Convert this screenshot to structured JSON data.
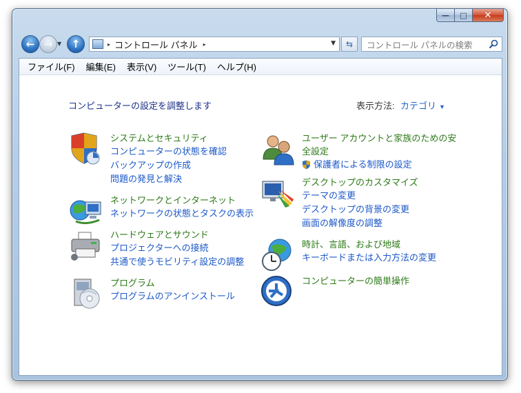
{
  "window": {
    "buttons": {
      "minimize": "—",
      "maximize": "□",
      "close": "✕"
    }
  },
  "nav": {
    "back_icon": "back-arrow-icon",
    "forward_icon": "forward-arrow-icon",
    "up_icon": "up-arrow-icon",
    "back_glyph": "←",
    "forward_glyph": "→",
    "up_glyph": "↑",
    "recent_glyph": "▼",
    "crumb_arrow": "▸",
    "address_crumb": "コントロール パネル",
    "address_drop_glyph": "▼",
    "refresh_glyph": "⇆",
    "search_placeholder": "コントロール パネルの検索"
  },
  "menu": [
    "ファイル(F)",
    "編集(E)",
    "表示(V)",
    "ツール(T)",
    "ヘルプ(H)"
  ],
  "page": {
    "title": "コンピューターの設定を調整します",
    "view_by_label": "表示方法:",
    "view_by_value": "カテゴリ",
    "view_by_caret": "▼"
  },
  "categories_left": [
    {
      "title": "システムとセキュリティ",
      "icon": "shield-icon",
      "links": [
        "コンピューターの状態を確認",
        "バックアップの作成",
        "問題の発見と解決"
      ]
    },
    {
      "title": "ネットワークとインターネット",
      "icon": "network-globe-icon",
      "links": [
        "ネットワークの状態とタスクの表示"
      ]
    },
    {
      "title": "ハードウェアとサウンド",
      "icon": "printer-icon",
      "links": [
        "プロジェクターへの接続",
        "共通で使うモビリティ設定の調整"
      ]
    },
    {
      "title": "プログラム",
      "icon": "programs-disc-icon",
      "links": [
        "プログラムのアンインストール"
      ]
    }
  ],
  "categories_right": [
    {
      "title": "ユーザー アカウントと家族のための安全設定",
      "icon": "users-icon",
      "links": [
        "保護者による制限の設定"
      ]
    },
    {
      "title": "デスクトップのカスタマイズ",
      "icon": "monitor-palette-icon",
      "links": [
        "テーマの変更",
        "デスクトップの背景の変更",
        "画面の解像度の調整"
      ]
    },
    {
      "title": "時計、言語、および地域",
      "icon": "clock-globe-icon",
      "links": [
        "キーボードまたは入力方法の変更"
      ]
    },
    {
      "title": "コンピューターの簡単操作",
      "icon": "ease-of-access-icon",
      "links": []
    }
  ]
}
